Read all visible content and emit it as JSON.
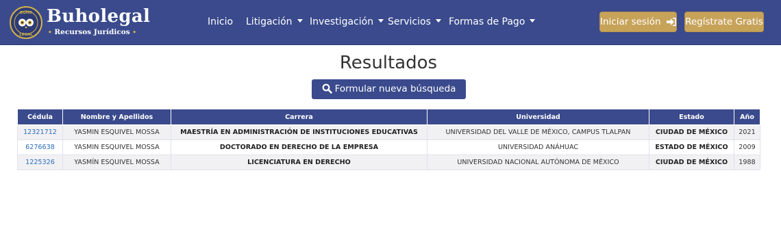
{
  "brand": {
    "name": "Buholegal",
    "tagline_left_dot": "•",
    "tagline": "Recursos Jurídicos",
    "tagline_right_dot": "•",
    "seal_text_top": "BUHO",
    "seal_text_bottom": "LEGAL"
  },
  "nav": {
    "items": [
      {
        "label": "Inicio",
        "dropdown": false
      },
      {
        "label": "Litigación",
        "dropdown": true
      },
      {
        "label": "Investigación",
        "dropdown": true
      },
      {
        "label": "Servicios",
        "dropdown": true
      },
      {
        "label": "Formas de Pago",
        "dropdown": true
      }
    ],
    "login_label": "Iniciar sesión",
    "register_label": "Regístrate Gratis"
  },
  "main": {
    "title": "Resultados",
    "new_search_label": "Formular nueva búsqueda"
  },
  "table": {
    "headers": [
      "Cédula",
      "Nombre y Apellidos",
      "Carrera",
      "Universidad",
      "Estado",
      "Año"
    ],
    "rows": [
      [
        "12321712",
        "YASMIN ESQUIVEL MOSSA",
        "MAESTRÍA EN ADMINISTRACIÓN DE INSTITUCIONES EDUCATIVAS",
        "UNIVERSIDAD DEL VALLE DE MÉXICO, CAMPUS TLALPAN",
        "CIUDAD DE MÉXICO",
        "2021"
      ],
      [
        "6276638",
        "YASMIN ESQUIVEL MOSSA",
        "DOCTORADO EN DERECHO DE LA EMPRESA",
        "UNIVERSIDAD ANÁHUAC",
        "ESTADO DE MÉXICO",
        "2009"
      ],
      [
        "1225326",
        "YASMÍN ESQUIVEL MOSSA",
        "LICENCIATURA EN DERECHO",
        "UNIVERSIDAD NACIONAL AUTÓNOMA DE MÉXICO",
        "CIUDAD DE MÉXICO",
        "1988"
      ]
    ]
  },
  "colors": {
    "navbar": "#3a4a8c",
    "gold_button": "#c7a35a",
    "link": "#2a6ebd"
  },
  "icons": {
    "login": "sign-in-icon",
    "search": "search-icon",
    "caret": "caret-down-icon",
    "logo": "owl-seal-logo"
  }
}
